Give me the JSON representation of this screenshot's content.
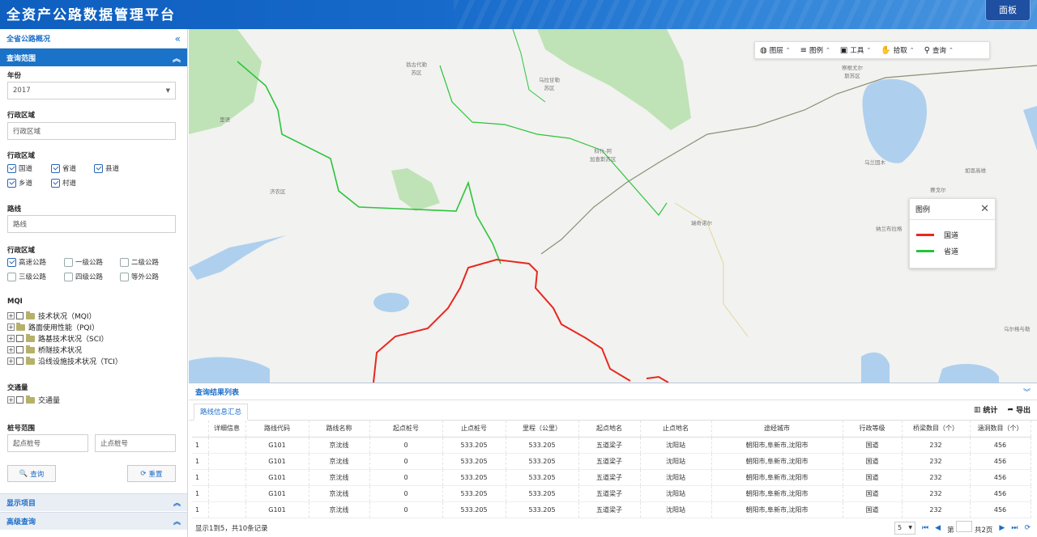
{
  "header": {
    "title": "全资产公路数据管理平台",
    "dashboard_btn": "面板"
  },
  "sidebar": {
    "top_title": "全省公路概况",
    "collapse": "«",
    "query_bar": "查询范围",
    "year_label": "年份",
    "year_value": "2017",
    "region_label": "行政区域",
    "region_placeholder": "行政区域",
    "road_type_label": "行政区域",
    "road_types": [
      {
        "label": "国道",
        "checked": true
      },
      {
        "label": "省道",
        "checked": true
      },
      {
        "label": "县道",
        "checked": true
      },
      {
        "label": "乡道",
        "checked": true
      },
      {
        "label": "村道",
        "checked": true
      }
    ],
    "route_label": "路线",
    "route_placeholder": "路线",
    "grade_label": "行政区域",
    "grades": [
      {
        "label": "高速公路",
        "checked": true
      },
      {
        "label": "一级公路",
        "checked": false
      },
      {
        "label": "二级公路",
        "checked": false
      },
      {
        "label": "三级公路",
        "checked": false
      },
      {
        "label": "四级公路",
        "checked": false
      },
      {
        "label": "等外公路",
        "checked": false
      }
    ],
    "mqi_label": "MQI",
    "mqi_items": [
      "技术状况（MQI）",
      "路面使用性能（PQI）",
      "路基技术状况（SCI）",
      "桥隧技术状况",
      "沿线设施技术状况（TCI）"
    ],
    "traffic_label": "交通量",
    "traffic_item": "交通量",
    "stake_label": "桩号范围",
    "stake_start_placeholder": "起点桩号",
    "stake_end_placeholder": "止点桩号",
    "query_btn": "查询",
    "reset_btn": "重置",
    "display_bar": "显示项目",
    "advanced_bar": "高级查询"
  },
  "map": {
    "toolbar": [
      {
        "icon": "globe-icon",
        "label": "图层"
      },
      {
        "icon": "list-icon",
        "label": "图例"
      },
      {
        "icon": "toolbox-icon",
        "label": "工具"
      },
      {
        "icon": "hand-icon",
        "label": "拾取"
      },
      {
        "icon": "search-icon",
        "label": "查询"
      }
    ],
    "legend_title": "图例",
    "legend_items": [
      {
        "label": "国道",
        "color": "#e8281e"
      },
      {
        "label": "省道",
        "color": "#26c23a"
      }
    ],
    "places": [
      "翁古代勒\n苏区",
      "乌拉甘勒\n苏区",
      "科什-阿\n加查斯苏区",
      "察根尤尔\n斯苏区",
      "乌兰固木",
      "如恩高维",
      "赛戈尔",
      "纳兰布拉格",
      "瑞奇诺尔",
      "济农区",
      "里语",
      "乌尔格与勒"
    ]
  },
  "results": {
    "title": "查询结果列表",
    "tab": "路线信息汇总",
    "stats_btn": "统计",
    "export_btn": "导出",
    "columns": [
      "",
      "详细信息",
      "路线代码",
      "路线名称",
      "起点桩号",
      "止点桩号",
      "里程（公里）",
      "起点地名",
      "止点地名",
      "途经城市",
      "行政等级",
      "桥梁数目（个）",
      "涵洞数目（个）"
    ],
    "rows": [
      [
        "1",
        "",
        "G101",
        "京沈线",
        "0",
        "533.205",
        "533.205",
        "五道梁子",
        "沈阳站",
        "朝阳市,阜新市,沈阳市",
        "国道",
        "232",
        "456"
      ],
      [
        "1",
        "",
        "G101",
        "京沈线",
        "0",
        "533.205",
        "533.205",
        "五道梁子",
        "沈阳站",
        "朝阳市,阜新市,沈阳市",
        "国道",
        "232",
        "456"
      ],
      [
        "1",
        "",
        "G101",
        "京沈线",
        "0",
        "533.205",
        "533.205",
        "五道梁子",
        "沈阳站",
        "朝阳市,阜新市,沈阳市",
        "国道",
        "232",
        "456"
      ],
      [
        "1",
        "",
        "G101",
        "京沈线",
        "0",
        "533.205",
        "533.205",
        "五道梁子",
        "沈阳站",
        "朝阳市,阜新市,沈阳市",
        "国道",
        "232",
        "456"
      ],
      [
        "1",
        "",
        "G101",
        "京沈线",
        "0",
        "533.205",
        "533.205",
        "五道梁子",
        "沈阳站",
        "朝阳市,阜新市,沈阳市",
        "国道",
        "232",
        "456"
      ]
    ],
    "footer_text": "显示1到5，共10条记录",
    "page_size": "5",
    "page_prefix": "第",
    "page_suffix": "共2页"
  }
}
